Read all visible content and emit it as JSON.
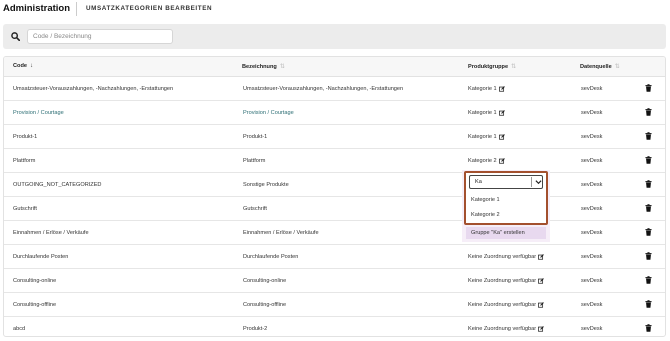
{
  "header": {
    "app_title": "Administration",
    "page_title": "UMSATZKATEGORIEN BEARBEITEN"
  },
  "search": {
    "placeholder": "Code / Bezeichnung"
  },
  "table": {
    "columns": {
      "code": "Code",
      "bezeichnung": "Bezeichnung",
      "produktgruppe": "Produktgruppe",
      "datenquelle": "Datenquelle"
    },
    "rows": [
      {
        "code": "Umsatzsteuer-Vorauszahlungen, -Nachzahlungen, -Erstattungen",
        "bezeichnung": "Umsatzsteuer-Vorauszahlungen, -Nachzahlungen, -Erstattungen",
        "gruppe": "Kategorie 1",
        "quelle": "sevDesk"
      },
      {
        "code": "Provision / Courtage",
        "bezeichnung": "Provision / Courtage",
        "gruppe": "Kategorie 1",
        "quelle": "sevDesk"
      },
      {
        "code": "Produkt-1",
        "bezeichnung": "Produkt-1",
        "gruppe": "Kategorie 1",
        "quelle": "sevDesk"
      },
      {
        "code": "Plattform",
        "bezeichnung": "Plattform",
        "gruppe": "Kategorie 2",
        "quelle": "sevDesk"
      },
      {
        "code": "OUTGOING_NOT_CATEGORIZED",
        "bezeichnung": "Sonstige Produkte",
        "gruppe": "",
        "quelle": "sevDesk"
      },
      {
        "code": "Gutschrift",
        "bezeichnung": "Gutschrift",
        "gruppe": "",
        "quelle": "sevDesk"
      },
      {
        "code": "Einnahmen / Erlöse / Verkäufe",
        "bezeichnung": "Einnahmen / Erlöse / Verkäufe",
        "gruppe": "",
        "quelle": "sevDesk"
      },
      {
        "code": "Durchlaufende Posten",
        "bezeichnung": "Durchlaufende Posten",
        "gruppe": "Keine Zuordnung verfügbar",
        "quelle": "sevDesk"
      },
      {
        "code": "Consulting-online",
        "bezeichnung": "Consulting-online",
        "gruppe": "Keine Zuordnung verfügbar",
        "quelle": "sevDesk"
      },
      {
        "code": "Consulting-offline",
        "bezeichnung": "Consulting-offline",
        "gruppe": "Keine Zuordnung verfügbar",
        "quelle": "sevDesk"
      },
      {
        "code": "abcd",
        "bezeichnung": "Produkt-2",
        "gruppe": "Keine Zuordnung verfügbar",
        "quelle": "sevDesk"
      }
    ]
  },
  "dropdown": {
    "value": "Ka",
    "options": [
      "Kategorie 1",
      "Kategorie 2"
    ],
    "create_label": "Gruppe \"Ka\" erstellen"
  },
  "colors": {
    "link_text": "#2c6e74",
    "dropdown_border": "#a3502e",
    "create_bg": "#e8d9ef"
  },
  "icons": {
    "search": "search-icon",
    "edit": "edit-icon",
    "delete": "trash-icon",
    "chevron": "chevron-down-icon"
  }
}
